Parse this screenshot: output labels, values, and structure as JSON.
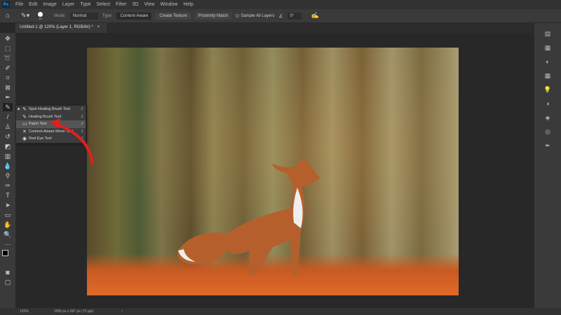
{
  "menubar": {
    "logo": "Ps",
    "items": [
      "File",
      "Edit",
      "Image",
      "Layer",
      "Type",
      "Select",
      "Filter",
      "3D",
      "View",
      "Window",
      "Help"
    ]
  },
  "options": {
    "mode_label": "Mode:",
    "mode_value": "Normal",
    "brush_size": "19",
    "type_label": "Type:",
    "type_buttons": [
      "Content-Aware",
      "Create Texture",
      "Proximity Match"
    ],
    "sample_all_layers": "Sample All Layers",
    "angle": "0°"
  },
  "document": {
    "tab_title": "Untitled-1 @ 120% (Layer 1, RGB/8#) *",
    "close": "×"
  },
  "flyout": {
    "items": [
      {
        "label": "Spot Healing Brush Tool",
        "key": "J",
        "icon": "✎"
      },
      {
        "label": "Healing Brush Tool",
        "key": "J",
        "icon": "✎"
      },
      {
        "label": "Patch Tool",
        "key": "J",
        "icon": "▭"
      },
      {
        "label": "Content-Aware Move Tool",
        "key": "J",
        "icon": "✕"
      },
      {
        "label": "Red Eye Tool",
        "key": "J",
        "icon": "◉"
      }
    ]
  },
  "status": {
    "zoom": "120%",
    "doc_info": "1000 px x 667 px (72 ppi)",
    "arrow": "›"
  },
  "colors": {
    "accent": "#31a8ff",
    "annotation_arrow": "#e0201e"
  }
}
